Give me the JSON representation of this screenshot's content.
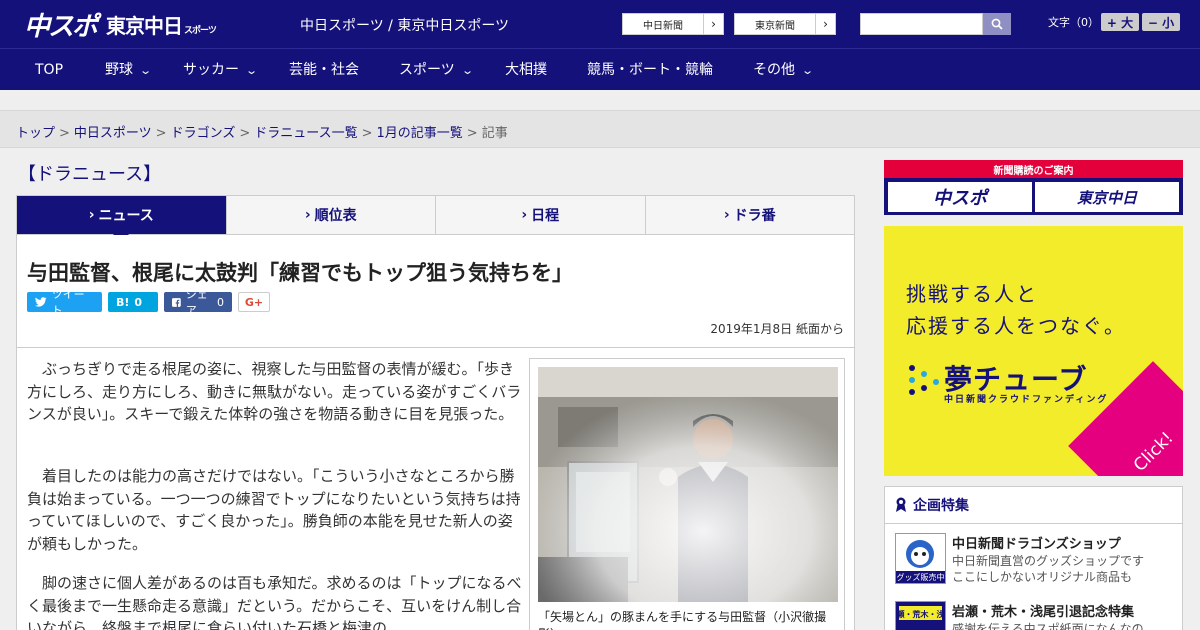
{
  "header": {
    "logo_chunichi_sports": "中スポ",
    "logo_tokyo": "東京中日",
    "logo_tokyo_suffix": "スポーツ",
    "site_name": "中日スポーツ / 東京中日スポーツ",
    "paper_links": [
      "中日新聞",
      "東京新聞"
    ],
    "search_placeholder": "",
    "fontsize_label": "文字（0）",
    "fontsize_up": "+ 大",
    "fontsize_down": "− 小"
  },
  "nav": {
    "items": [
      {
        "label": "TOP",
        "has_menu": false
      },
      {
        "label": "野球",
        "has_menu": true
      },
      {
        "label": "サッカー",
        "has_menu": true
      },
      {
        "label": "芸能・社会",
        "has_menu": false
      },
      {
        "label": "スポーツ",
        "has_menu": true
      },
      {
        "label": "大相撲",
        "has_menu": false
      },
      {
        "label": "競馬・ボート・競輪",
        "has_menu": false
      },
      {
        "label": "その他",
        "has_menu": true
      }
    ]
  },
  "breadcrumb": {
    "items": [
      "トップ",
      "中日スポーツ",
      "ドラゴンズ",
      "ドラニュース一覧",
      "1月の記事一覧"
    ],
    "current": "記事",
    "separator": ">"
  },
  "section": {
    "title": "【ドラニュース】",
    "tabs": [
      "ニュース",
      "順位表",
      "日程",
      "ドラ番"
    ],
    "active_tab": 0
  },
  "article": {
    "headline": "与田監督、根尾に太鼓判「練習でもトップ狙う気持ちを」",
    "share": {
      "tweet": "ツイート",
      "hatena": "B!",
      "hatena_count": "0",
      "facebook": "シェア",
      "facebook_count": "0",
      "gplus": "G+"
    },
    "dateline": "2019年1月8日 紙面から",
    "paragraphs": [
      "ぶっちぎりで走る根尾の姿に、視察した与田監督の表情が緩む。「歩き方にしろ、走り方にしろ、動きに無駄がない。走っている姿がすごくバランスが良い」。スキーで鍛えた体幹の強さを物語る動きに目を見張った。",
      "着目したのは能力の高さだけではない。「こういう小さなところから勝負は始まっている。一つ一つの練習でトップになりたいという気持ちは持っていてほしいので、すごく良かった」。勝負師の本能を見せた新人の姿が頼もしかった。",
      "脚の速さに個人差があるのは百も承知だ。求めるのは「トップになるべく最後まで一生懸命走る意識」だという。だからこそ、互いをけん制し合いながら、終盤まで根尾に食らい付いた石橋と梅津の"
    ],
    "photo_caption": "「矢場とん」の豚まんを手にする与田監督（小沢徹撮影）"
  },
  "sidebar": {
    "ad_subscribe": {
      "title": "新聞購読のご案内",
      "logos": [
        "中スポ",
        "東京中日"
      ]
    },
    "ad_yume": {
      "line1": "挑戦する人と",
      "line2": "応援する人をつなぐ。",
      "brand": "夢チューブ",
      "sub": "中日新聞クラウドファンディング",
      "click": "Click!"
    },
    "features": {
      "title": "企画特集",
      "items": [
        {
          "title": "中日新聞ドラゴンズショップ",
          "desc": [
            "中日新聞直営のグッズショップです",
            "ここにしかないオリジナル商品も"
          ],
          "thumb_text": "グッズ販売中"
        },
        {
          "title": "岩瀬・荒木・浅尾引退記念特集",
          "desc": [
            "感謝を伝える中スポ紙面になんなの"
          ],
          "thumb_text": "岩瀬・荒木・浅尾"
        }
      ]
    }
  },
  "colors": {
    "brand_navy": "#15117a",
    "accent_red": "#e4003a",
    "ad_yellow": "#f3ec2a",
    "ad_pink": "#e4007f",
    "twitter": "#1da1f2",
    "hatena": "#00a4de",
    "facebook": "#3b5998"
  }
}
